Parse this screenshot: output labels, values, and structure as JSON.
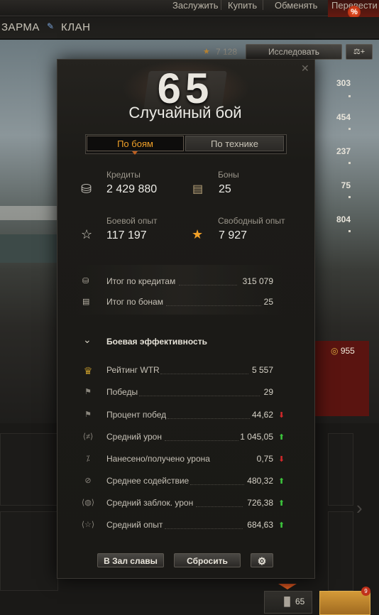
{
  "topbar": {
    "items": [
      "Заслужить",
      "Купить",
      "Обменять",
      "Перевести"
    ],
    "discount_badge": "%"
  },
  "nav": {
    "items": [
      "ЗАРМА",
      "КЛАН"
    ]
  },
  "research": {
    "xp": "7 128",
    "button_label": "Исследовать"
  },
  "side_stats": [
    "303",
    "454",
    "237",
    "75",
    "804"
  ],
  "gold": "955",
  "bottom": {
    "battles": "65",
    "badge": "9"
  },
  "modal": {
    "battle_count": "65",
    "title": "Случайный бой",
    "tabs": [
      "По боям",
      "По технике"
    ],
    "active_tab": "По боям",
    "credits_label": "Кредиты",
    "credits_value": "2 429 880",
    "bonds_label": "Боны",
    "bonds_value": "25",
    "combat_xp_label": "Боевой опыт",
    "combat_xp_value": "117 197",
    "free_xp_label": "Свободный опыт",
    "free_xp_value": "7 927",
    "totals": [
      {
        "label": "Итог по кредитам",
        "value": "315 079"
      },
      {
        "label": "Итог по бонам",
        "value": "25"
      }
    ],
    "efficiency_title": "Боевая эффективность",
    "efficiency": [
      {
        "label": "Рейтинг WTR",
        "value": "5 557",
        "trend": "none",
        "icon": "wtr-icon"
      },
      {
        "label": "Победы",
        "value": "29",
        "trend": "none",
        "icon": "flag-icon"
      },
      {
        "label": "Процент побед",
        "value": "44,62",
        "trend": "down",
        "icon": "flag-icon"
      },
      {
        "label": "Средний урон",
        "value": "1 045,05",
        "trend": "up",
        "icon": "damage-icon"
      },
      {
        "label": "Нанесено/получено урона",
        "value": "0,75",
        "trend": "down",
        "icon": "ratio-icon"
      },
      {
        "label": "Среднее содействие",
        "value": "480,32",
        "trend": "up",
        "icon": "assist-icon"
      },
      {
        "label": "Средний заблок. урон",
        "value": "726,38",
        "trend": "up",
        "icon": "shield-icon"
      },
      {
        "label": "Средний опыт",
        "value": "684,63",
        "trend": "up",
        "icon": "star-icon"
      }
    ],
    "buttons": {
      "hall_of_fame": "В Зал славы",
      "reset": "Сбросить"
    },
    "colors": {
      "accent": "#f0a028",
      "up": "#3cc43c",
      "down": "#d0282a"
    }
  }
}
